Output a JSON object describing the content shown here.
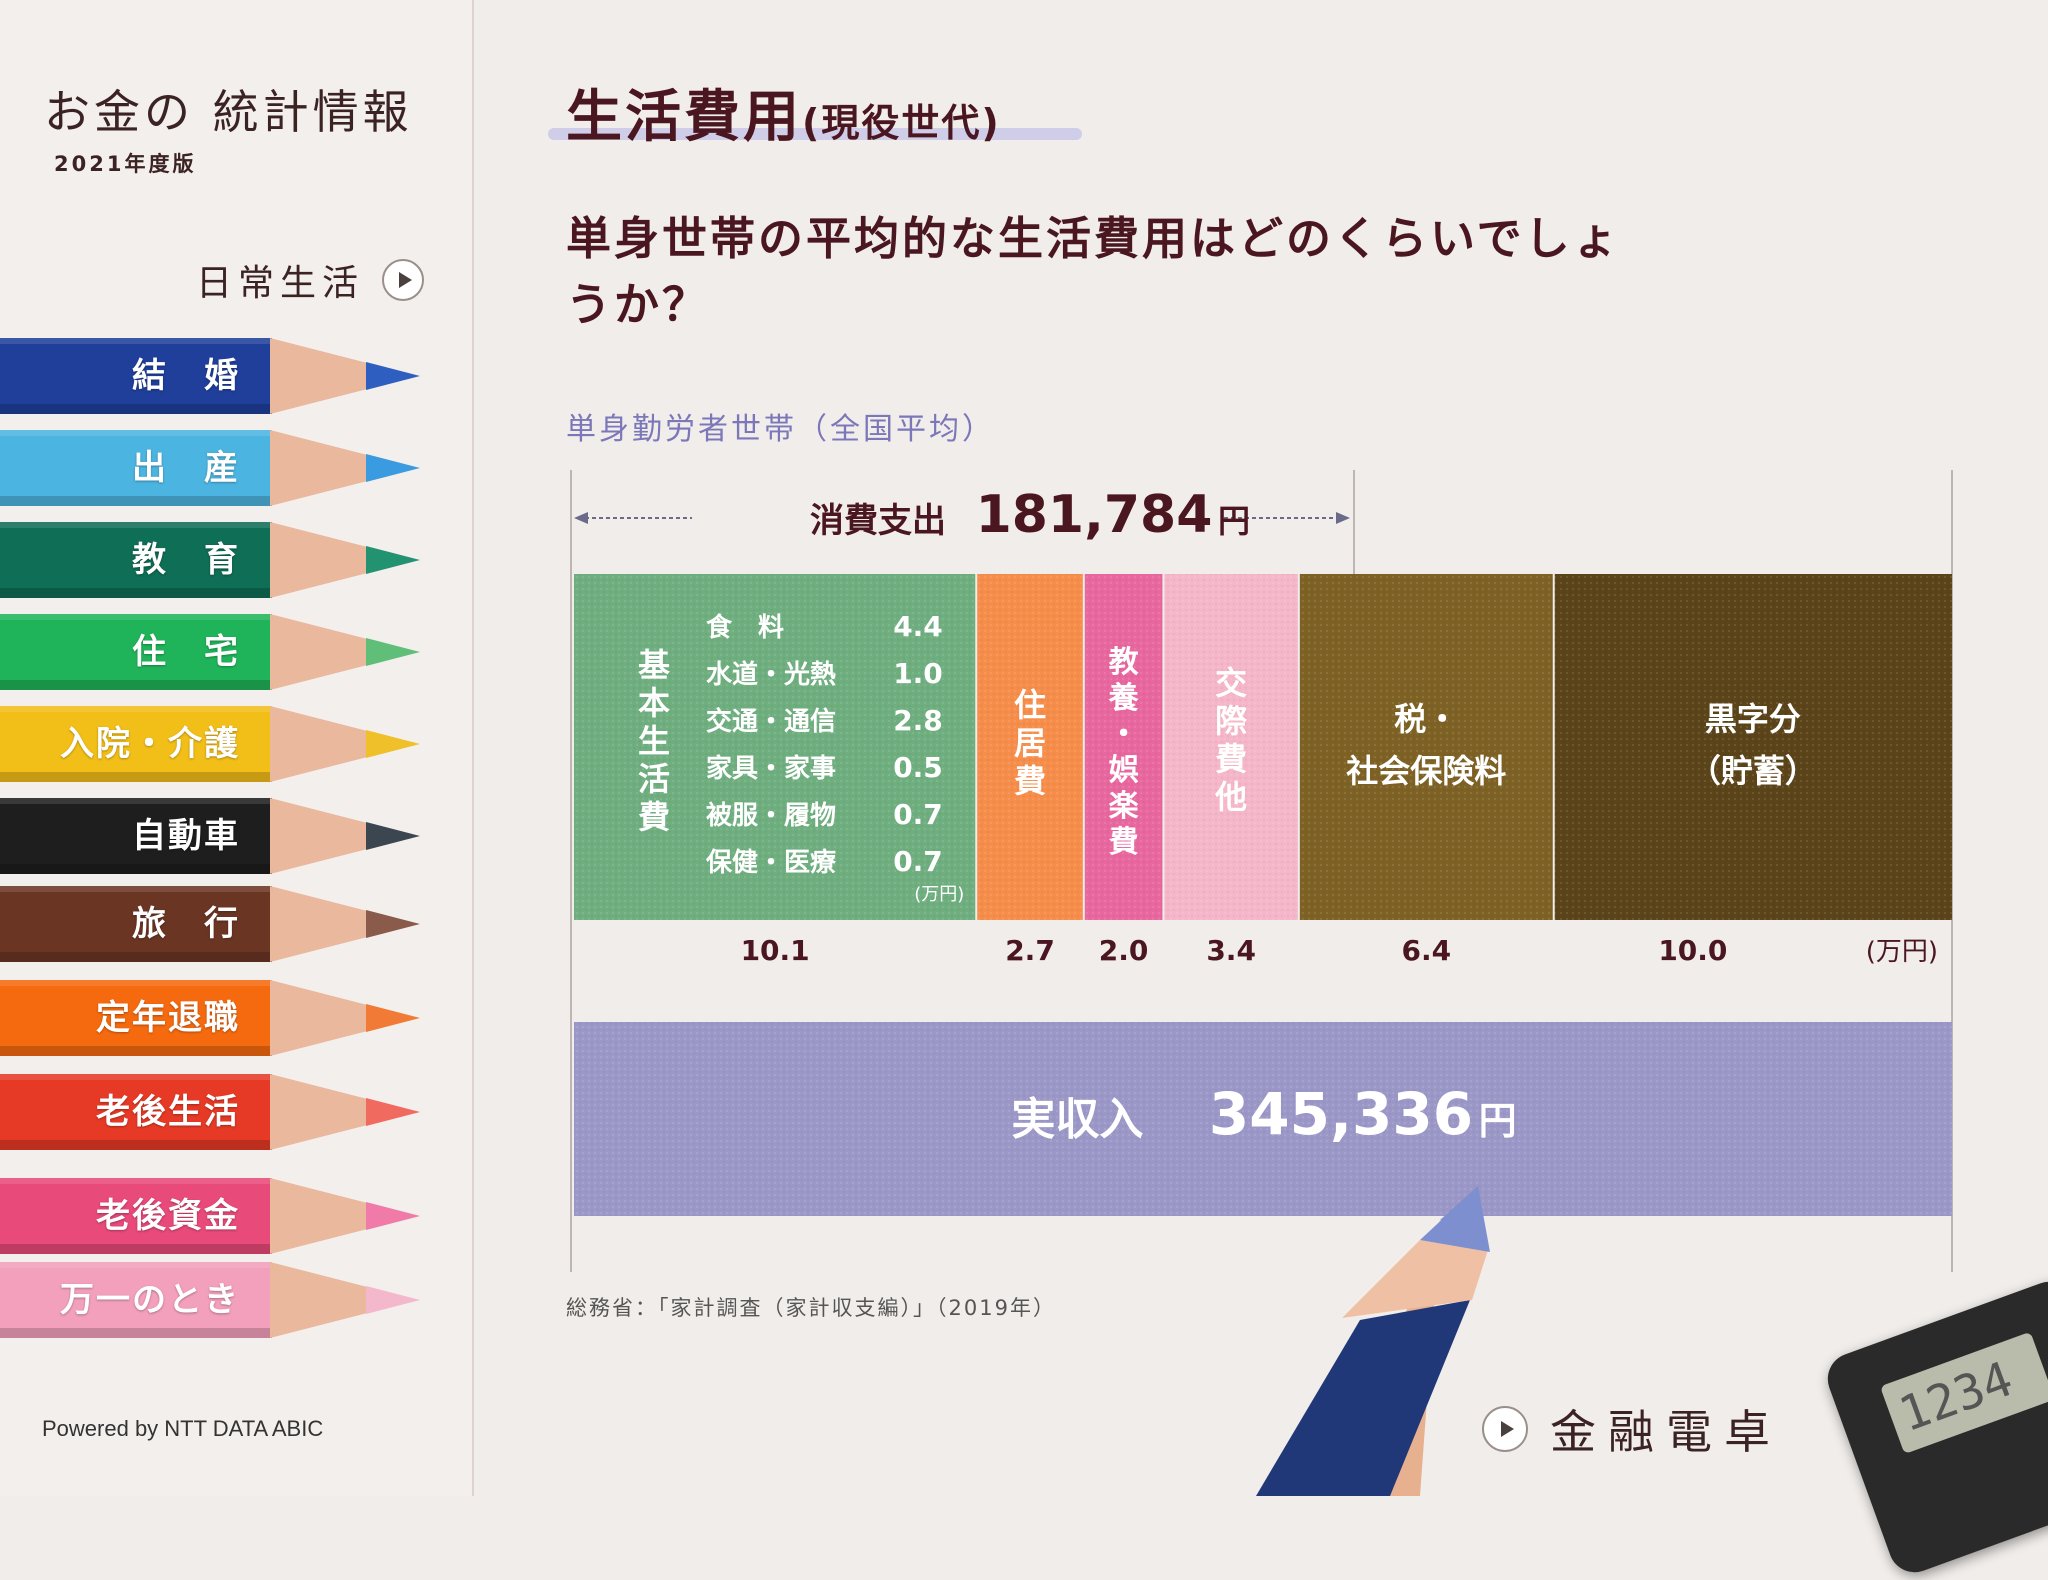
{
  "sidebar": {
    "brand_title": "お金の 統計情報",
    "brand_year": "2021年度版",
    "daily_life": "日常生活",
    "items": [
      {
        "label": "結　婚",
        "color": "#1f3f9a",
        "tip": "#2e5fc0"
      },
      {
        "label": "出　産",
        "color": "#4cb4e0",
        "tip": "#3a9be0"
      },
      {
        "label": "教　育",
        "color": "#0f6e56",
        "tip": "#239270"
      },
      {
        "label": "住　宅",
        "color": "#20b45a",
        "tip": "#5fbf78"
      },
      {
        "label": "入院・介護",
        "color": "#f2be18",
        "tip": "#f0c02a"
      },
      {
        "label": "自動車",
        "color": "#1e1e1e",
        "tip": "#3c4650"
      },
      {
        "label": "旅　行",
        "color": "#6b3524",
        "tip": "#8a5a4a"
      },
      {
        "label": "定年退職",
        "color": "#f56a0f",
        "tip": "#f07a36"
      },
      {
        "label": "老後生活",
        "color": "#e63a26",
        "tip": "#f06a60"
      },
      {
        "label": "老後資金",
        "color": "#e84a7a",
        "tip": "#f07aa8"
      },
      {
        "label": "万一のとき",
        "color": "#f2a0bb",
        "tip": "#f4b8cc"
      }
    ],
    "powered_by": "Powered by NTT DATA ABIC"
  },
  "main": {
    "title": "生活費用",
    "title_sub": "(現役世代)",
    "question": "単身世帯の平均的な生活費用はどのくらいでしょうか？",
    "subtitle": "単身勤労者世帯（全国平均）",
    "source": "総務省：「家計調査（家計収支編）」（2019年）",
    "calc_link": "金融電卓",
    "calculator_display": "1234"
  },
  "chart_data": {
    "type": "bar",
    "orientation": "horizontal-stacked",
    "unit": "万円",
    "consumption_label": "消費支出",
    "consumption_value": "181,784",
    "consumption_unit": "円",
    "income_label": "実収入",
    "income_value": "345,336",
    "income_unit": "円",
    "segments": [
      {
        "name": "基本生活費",
        "value": 10.1,
        "value_label": "10.1",
        "color": "#6fae7f"
      },
      {
        "name": "住居費",
        "value": 2.7,
        "value_label": "2.7",
        "color": "#f68d4a"
      },
      {
        "name": "教養・娯楽費",
        "value": 2.0,
        "value_label": "2.0",
        "color": "#e8679f"
      },
      {
        "name": "交際費他",
        "value": 3.4,
        "value_label": "3.4",
        "color": "#f4b6c8"
      },
      {
        "name": "税・社会保険料",
        "value": 6.4,
        "value_label": "6.4",
        "color": "#7e6124"
      },
      {
        "name": "黒字分（貯蓄）",
        "value": 10.0,
        "value_label": "10.0",
        "color": "#5b4419"
      }
    ],
    "basic_breakdown": [
      {
        "name": "食　料",
        "value": "4.4"
      },
      {
        "name": "水道・光熱",
        "value": "1.0"
      },
      {
        "name": "交通・通信",
        "value": "2.8"
      },
      {
        "name": "家具・家事",
        "value": "0.5"
      },
      {
        "name": "被服・履物",
        "value": "0.7"
      },
      {
        "name": "保健・医療",
        "value": "0.7"
      }
    ],
    "breakdown_unit": "(万円)",
    "values_unit": "(万円)",
    "vertical_labels": {
      "basic": "基本生活費",
      "housing": "住居費",
      "culture": "教養・娯楽費",
      "social": "交際費他"
    },
    "tax_label": [
      "税・",
      "社会保険料"
    ],
    "surplus_label": [
      "黒字分",
      "（貯蓄）"
    ],
    "income_color": "#9b98c8"
  }
}
